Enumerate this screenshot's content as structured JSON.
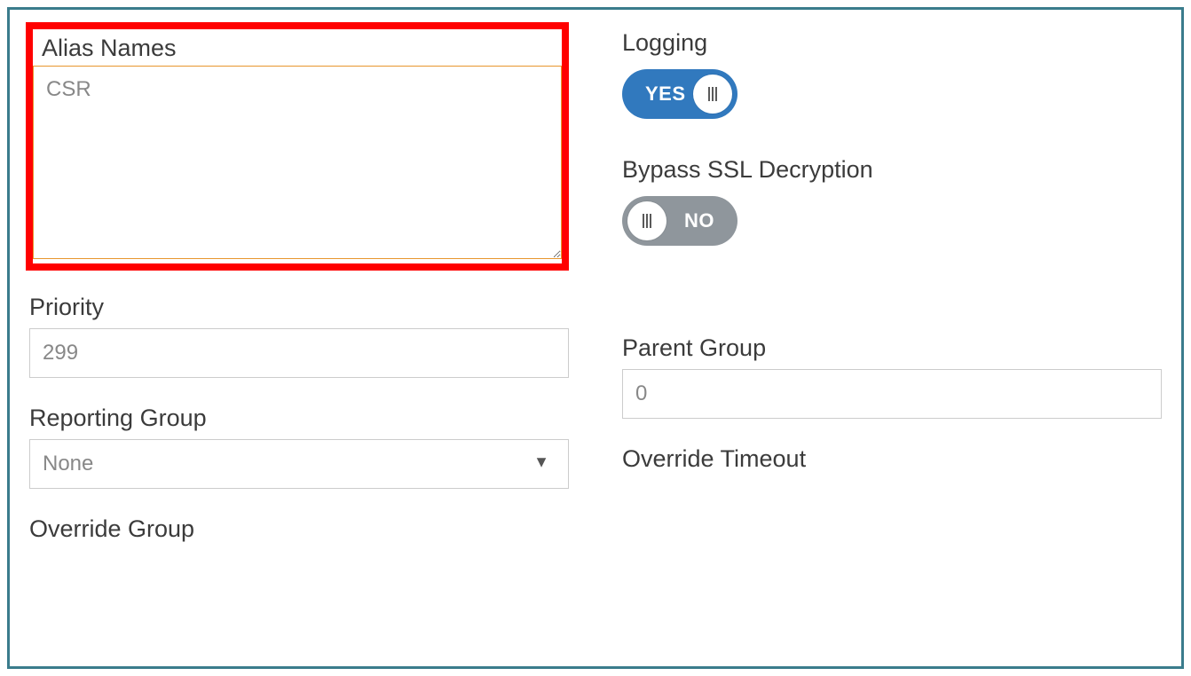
{
  "aliasNames": {
    "label": "Alias Names",
    "value": "CSR"
  },
  "priority": {
    "label": "Priority",
    "value": "299"
  },
  "reportingGroup": {
    "label": "Reporting Group",
    "selected": "None"
  },
  "overrideGroup": {
    "label": "Override Group"
  },
  "logging": {
    "label": "Logging",
    "state": "YES"
  },
  "bypassSSL": {
    "label": "Bypass SSL Decryption",
    "state": "NO"
  },
  "parentGroup": {
    "label": "Parent Group",
    "value": "0"
  },
  "overrideTimeout": {
    "label": "Override Timeout"
  }
}
